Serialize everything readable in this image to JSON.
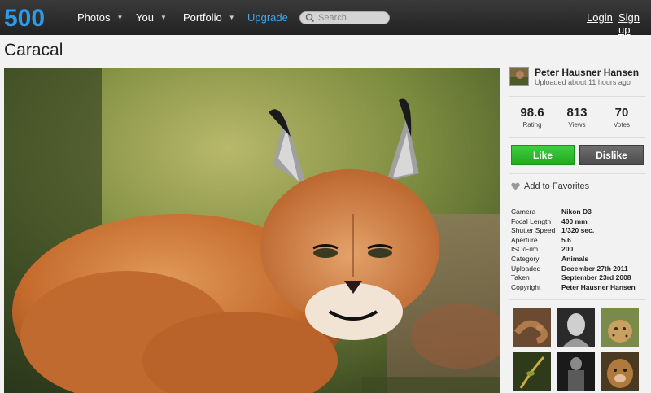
{
  "header": {
    "logo_text": "500",
    "nav": [
      {
        "label": "Photos",
        "has_menu": true
      },
      {
        "label": "You",
        "has_menu": true
      },
      {
        "label": "Portfolio",
        "has_menu": true
      },
      {
        "label": "Upgrade",
        "has_menu": false
      }
    ],
    "search_placeholder": "Search",
    "login_label": "Login",
    "signup_label": "Sign up",
    "colors": {
      "bar": "#2b2b2b",
      "logo": "#2e9be8",
      "upgrade": "#3ea8ee"
    }
  },
  "photo": {
    "title": "Caracal"
  },
  "author": {
    "name": "Peter Hausner Hansen",
    "uploaded": "Uploaded about 11 hours ago"
  },
  "stats": [
    {
      "value": "98.6",
      "label": "Rating"
    },
    {
      "value": "813",
      "label": "Views"
    },
    {
      "value": "70",
      "label": "Votes"
    }
  ],
  "actions": {
    "like_label": "Like",
    "dislike_label": "Dislike",
    "favorite_label": "Add to Favorites",
    "colors": {
      "like": "#2bb52b",
      "dislike": "#5a5a5a"
    }
  },
  "exif": [
    {
      "key": "Camera",
      "value": "Nikon D3"
    },
    {
      "key": "Focal Length",
      "value": "400 mm"
    },
    {
      "key": "Shutter Speed",
      "value": "1/320 sec."
    },
    {
      "key": "Aperture",
      "value": "5.6"
    },
    {
      "key": "ISO/Film",
      "value": "200"
    },
    {
      "key": "Category",
      "value": "Animals"
    },
    {
      "key": "Uploaded",
      "value": "December 27th 2011"
    },
    {
      "key": "Taken",
      "value": "September 23rd 2008"
    },
    {
      "key": "Copyright",
      "value": "Peter Hausner Hansen"
    }
  ],
  "thumbnails": [
    {
      "subject": "snake"
    },
    {
      "subject": "woman portrait bw"
    },
    {
      "subject": "leopard cub"
    },
    {
      "subject": "plant macro"
    },
    {
      "subject": "figure bw"
    },
    {
      "subject": "lion"
    }
  ]
}
